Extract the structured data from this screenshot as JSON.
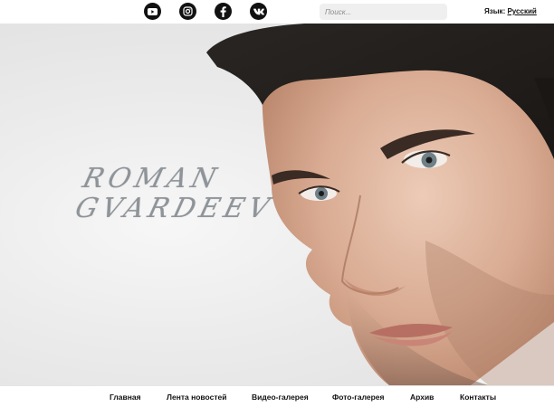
{
  "header": {
    "social": [
      {
        "icon": "youtube-icon",
        "label": "YouTube"
      },
      {
        "icon": "instagram-icon",
        "label": "Instagram"
      },
      {
        "icon": "facebook-icon",
        "label": "Facebook"
      },
      {
        "icon": "vk-icon",
        "label": "VK"
      }
    ],
    "search": {
      "placeholder": "Поиск..."
    },
    "language": {
      "label": "Язык:",
      "value": "Русский"
    }
  },
  "hero": {
    "brand_line1": "ROMAN",
    "brand_line2": "GVARDEEV"
  },
  "nav": {
    "items": [
      {
        "label": "Главная"
      },
      {
        "label": "Лента новостей"
      },
      {
        "label": "Видео-галерея"
      },
      {
        "label": "Фото-галерея"
      },
      {
        "label": "Архив"
      },
      {
        "label": "Контакты"
      }
    ]
  },
  "colors": {
    "background": "#ffffff",
    "icon": "#111111",
    "search_bg": "#efefef",
    "brand_text": "#8e9499"
  }
}
